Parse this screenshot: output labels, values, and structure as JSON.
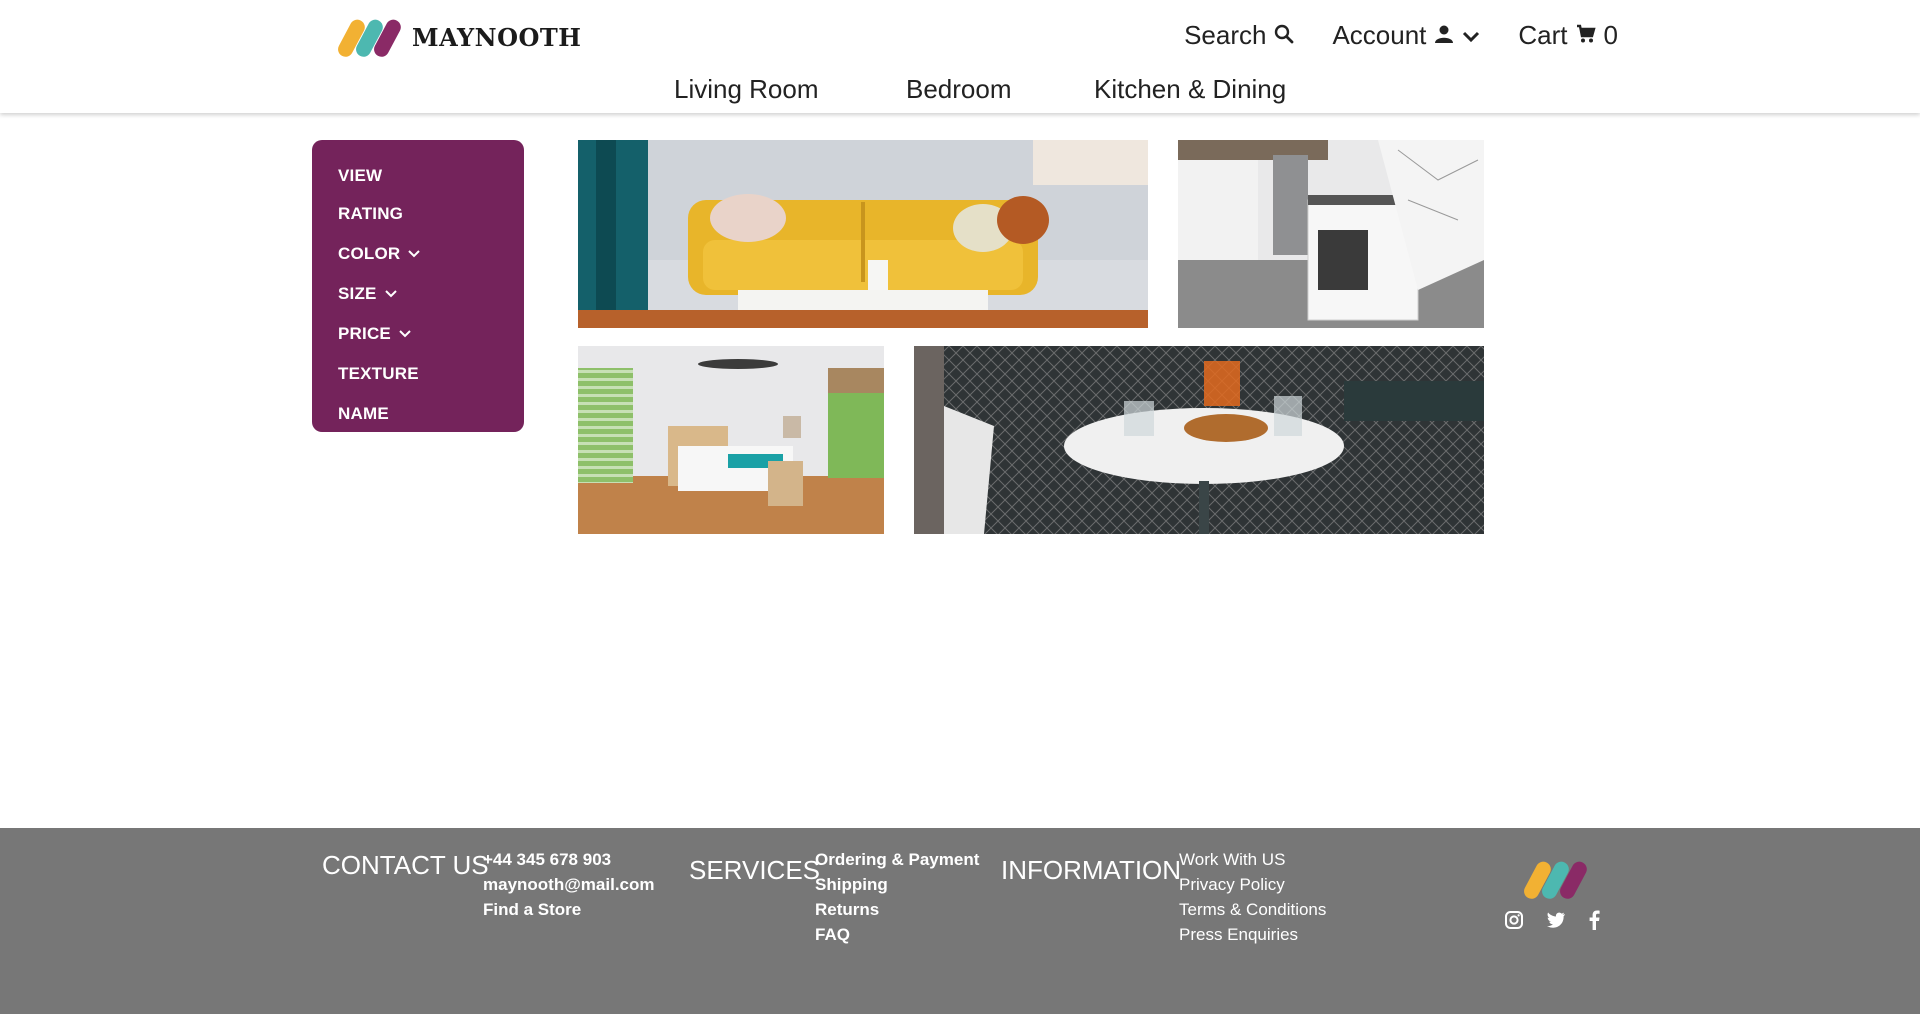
{
  "brand": {
    "name": "MAYNOOTH",
    "logo_colors": [
      "#f2b133",
      "#4db8b0",
      "#8a2a66"
    ]
  },
  "topnav": {
    "search_label": "Search",
    "account_label": "Account",
    "cart_label": "Cart",
    "cart_count": "0"
  },
  "mainnav": [
    {
      "label": "Living Room"
    },
    {
      "label": "Bedroom"
    },
    {
      "label": "Kitchen & Dining"
    }
  ],
  "sidebar": {
    "color": "#74235b",
    "filters": [
      {
        "label": "VIEW",
        "has_dropdown": false
      },
      {
        "label": "RATING",
        "has_dropdown": false
      },
      {
        "label": "COLOR",
        "has_dropdown": true
      },
      {
        "label": "SIZE",
        "has_dropdown": true
      },
      {
        "label": "PRICE",
        "has_dropdown": true
      },
      {
        "label": "TEXTURE",
        "has_dropdown": false
      },
      {
        "label": "NAME",
        "has_dropdown": false
      }
    ]
  },
  "gallery": [
    {
      "name": "living-room-photo"
    },
    {
      "name": "kitchen-photo"
    },
    {
      "name": "bedroom-photo"
    },
    {
      "name": "dining-photo"
    }
  ],
  "footer": {
    "background": "#777777",
    "contact": {
      "heading": "CONTACT US",
      "items": [
        "+44 345 678 903",
        "maynooth@mail.com",
        "Find a Store"
      ]
    },
    "services": {
      "heading": "SERVICES",
      "items": [
        "Ordering & Payment",
        "Shipping",
        "Returns",
        "FAQ"
      ]
    },
    "information": {
      "heading": "INFORMATION",
      "items": [
        "Work With US",
        "Privacy Policy",
        "Terms & Conditions",
        "Press Enquiries"
      ]
    },
    "social_icons": [
      "instagram-icon",
      "twitter-icon",
      "facebook-icon"
    ]
  }
}
